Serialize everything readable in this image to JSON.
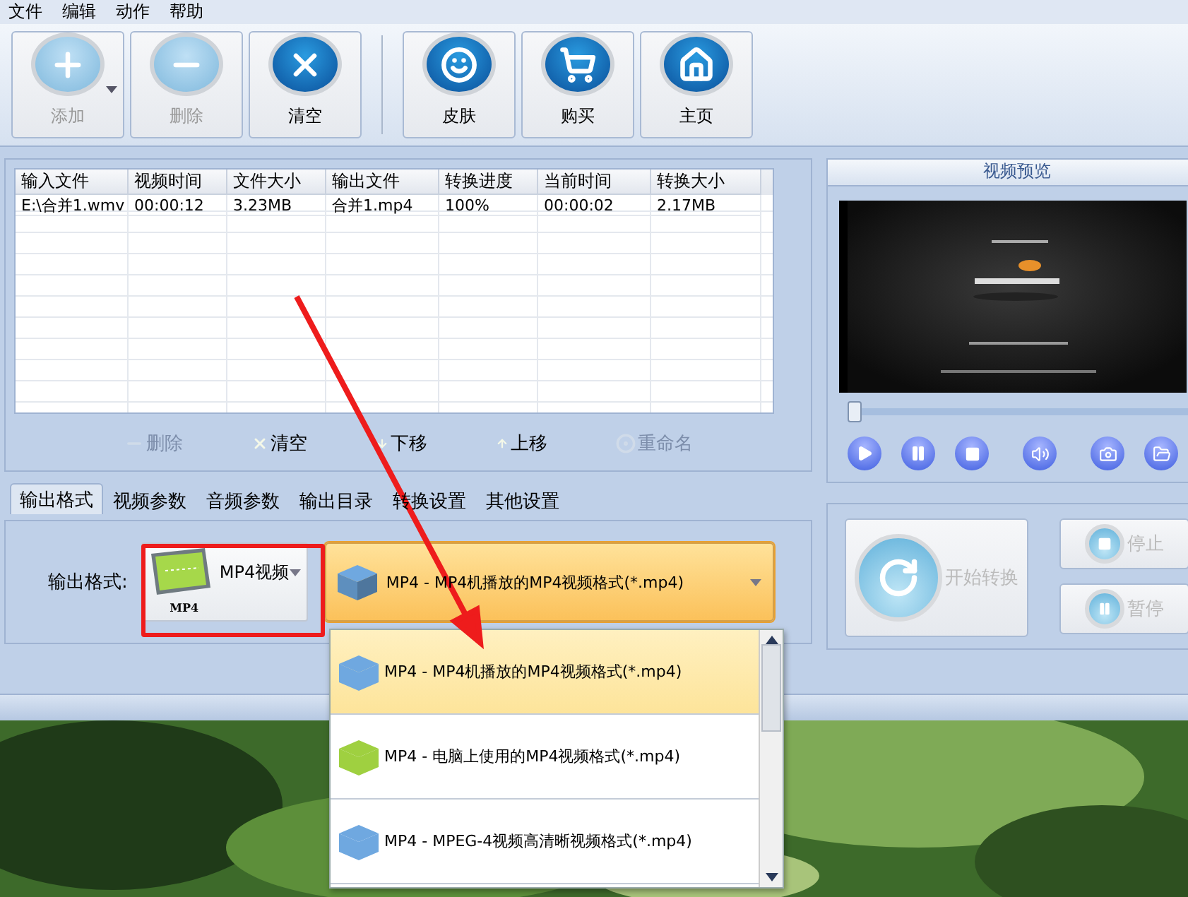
{
  "menu": [
    "文件",
    "编辑",
    "动作",
    "帮助"
  ],
  "toolbar": [
    {
      "label": "添加",
      "disabled": true,
      "menu": true
    },
    {
      "label": "删除",
      "disabled": true,
      "menu": false
    },
    {
      "label": "清空",
      "disabled": false,
      "menu": false
    },
    {
      "kind": "separator"
    },
    {
      "label": "皮肤",
      "disabled": false,
      "menu": false
    },
    {
      "label": "购买",
      "disabled": false,
      "menu": false
    },
    {
      "label": "主页",
      "disabled": false,
      "menu": false
    }
  ],
  "table": {
    "columns": [
      "输入文件",
      "视频时间",
      "文件大小",
      "输出文件",
      "转换进度",
      "当前时间",
      "转换大小"
    ],
    "rows": [
      [
        "E:\\合并1.wmv",
        "00:00:12",
        "3.23MB",
        "合并1.mp4",
        "100%",
        "00:00:02",
        "2.17MB"
      ]
    ]
  },
  "list_actions": [
    {
      "label": "删除",
      "disabled": true
    },
    {
      "label": "清空",
      "disabled": false
    },
    {
      "label": "下移",
      "disabled": false
    },
    {
      "label": "上移",
      "disabled": false
    },
    {
      "label": "重命名",
      "disabled": true
    }
  ],
  "preview": {
    "title": "视频预览",
    "position": {
      "level": 0
    }
  },
  "tabs": [
    {
      "label": "输出格式",
      "selected": true
    },
    {
      "label": "视频参数",
      "selected": false
    },
    {
      "label": "音频参数",
      "selected": false
    },
    {
      "label": "输出目录",
      "selected": false
    },
    {
      "label": "转换设置",
      "selected": false
    },
    {
      "label": "其他设置",
      "selected": false
    }
  ],
  "output": {
    "label": "输出格式:",
    "format": {
      "name": "MP4视频",
      "icon_caption": "MP4"
    },
    "profile": {
      "value": "MP4 - MP4机播放的MP4视频格式(*.mp4)",
      "expanded": true
    }
  },
  "profile_options": [
    {
      "label": "MP4 - MP4机播放的MP4视频格式(*.mp4)",
      "color": "#6fa8e0",
      "selected": true
    },
    {
      "label": "MP4 - 电脑上使用的MP4视频格式(*.mp4)",
      "color": "#9fd040",
      "selected": false
    },
    {
      "label": "MP4 - MPEG-4视频高清晰视频格式(*.mp4)",
      "color": "#6fa8e0",
      "selected": false
    }
  ],
  "convert": {
    "start": {
      "label": "开始转换",
      "disabled": true
    },
    "stop": {
      "label": "停止",
      "disabled": true
    },
    "pause": {
      "label": "暂停",
      "disabled": true
    }
  }
}
